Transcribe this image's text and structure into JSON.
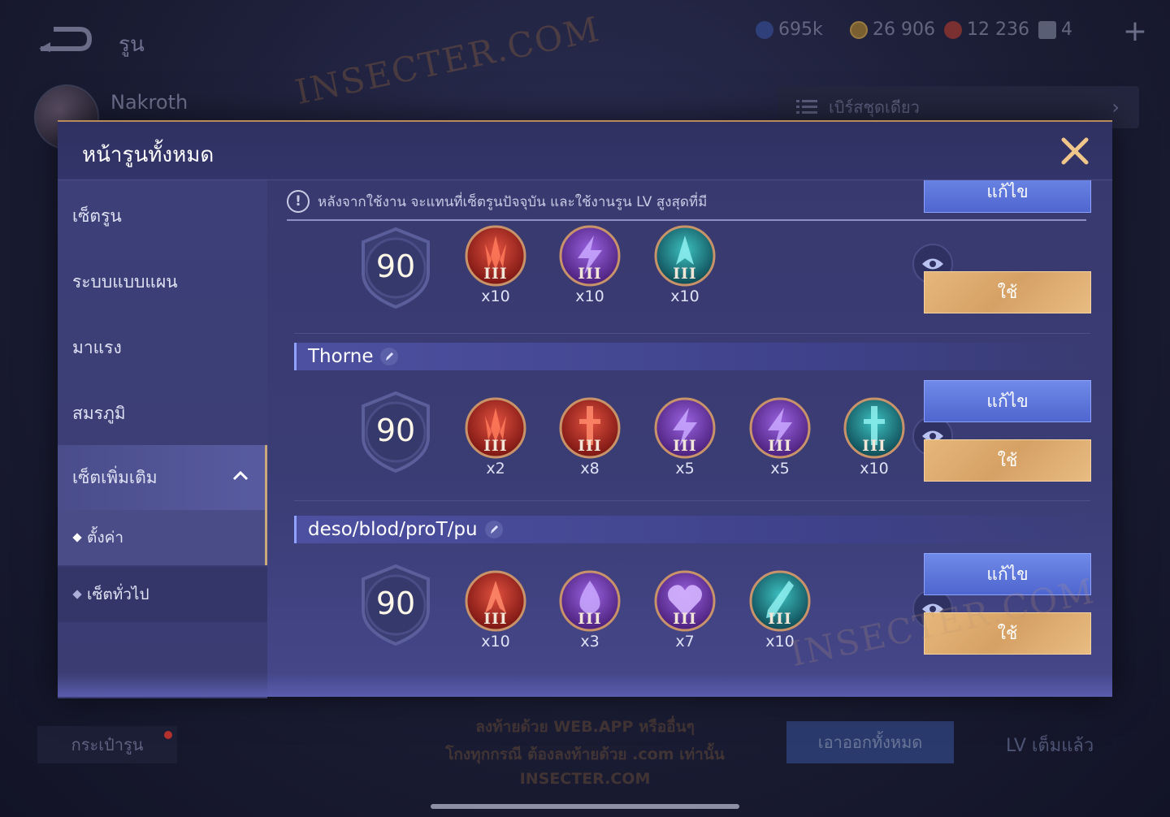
{
  "background": {
    "screen_title": "รูน",
    "resources": [
      {
        "icon": "diamond-gem-icon",
        "value": "695k",
        "color": "#3d5fd0"
      },
      {
        "icon": "gold-coin-icon",
        "value": "26 906",
        "color": "#d8a030"
      },
      {
        "icon": "ruby-gem-icon",
        "value": "12 236",
        "color": "#c33b2e"
      },
      {
        "icon": "rune-ticket-icon",
        "value": "4",
        "color": "#c7ccd8"
      }
    ],
    "hero_name": "Nakroth",
    "single_set_label": "เบิร์สชุดเดียว",
    "watermark_text": "INSECTER.COM",
    "bottom_left_button": "กระเป๋ารูน",
    "remove_all_button": "เอาออกทั้งหมด",
    "lv_full_label": "LV เต็มแล้ว",
    "notice_line1": "ลงท้ายด้วย WEB.APP หรืออื่นๆ",
    "notice_line2": "โกงทุกกรณี ต้องลงท้ายด้วย .com เท่านั้น",
    "notice_line3": "INSECTER.COM"
  },
  "modal": {
    "title": "หน้ารูนทั้งหมด",
    "info_text": "หลังจากใช้งาน จะแทนที่เซ็ตรูนปัจจุบัน และใช้งานรูน LV สูงสุดที่มี",
    "sidebar": {
      "items": [
        {
          "label": "เซ็ตรูน"
        },
        {
          "label": "ระบบแบบแผน"
        },
        {
          "label": "มาแรง"
        },
        {
          "label": "สมรภูมิ"
        },
        {
          "label": "เซ็ตเพิ่มเติม"
        }
      ],
      "sub_items": [
        {
          "label": "ตั้งค่า"
        },
        {
          "label": "เซ็ตทั่วไป"
        }
      ]
    },
    "sets": [
      {
        "name": "",
        "level": "90",
        "edit_label": "แก้ไข",
        "use_label": "ใช้",
        "runes": [
          {
            "icon": "red-claw-rune-icon",
            "color": "red",
            "tier": "III",
            "count": "x10"
          },
          {
            "icon": "purple-bolt-rune-icon",
            "color": "purple",
            "tier": "III",
            "count": "x10"
          },
          {
            "icon": "teal-fang-rune-icon",
            "color": "teal",
            "tier": "III",
            "count": "x10"
          }
        ]
      },
      {
        "name": "Thorne",
        "level": "90",
        "edit_label": "แก้ไข",
        "use_label": "ใช้",
        "runes": [
          {
            "icon": "red-claw-rune-icon",
            "color": "red",
            "tier": "III",
            "count": "x2"
          },
          {
            "icon": "red-sword-rune-icon",
            "color": "red",
            "tier": "III",
            "count": "x8"
          },
          {
            "icon": "purple-bolt-rune-icon",
            "color": "purple",
            "tier": "III",
            "count": "x5"
          },
          {
            "icon": "purple-bolt-rune-icon",
            "color": "purple",
            "tier": "III",
            "count": "x5"
          },
          {
            "icon": "teal-sword-rune-icon",
            "color": "teal",
            "tier": "III",
            "count": "x10"
          }
        ]
      },
      {
        "name": "deso/blod/proT/pu",
        "level": "90",
        "edit_label": "แก้ไข",
        "use_label": "ใช้",
        "runes": [
          {
            "icon": "red-fang-rune-icon",
            "color": "red",
            "tier": "III",
            "count": "x10"
          },
          {
            "icon": "purple-drop-rune-icon",
            "color": "purple",
            "tier": "III",
            "count": "x3"
          },
          {
            "icon": "purple-heart-rune-icon",
            "color": "purple",
            "tier": "III",
            "count": "x7"
          },
          {
            "icon": "teal-blade-rune-icon",
            "color": "teal",
            "tier": "III",
            "count": "x10"
          }
        ]
      }
    ]
  },
  "colors": {
    "accent_gold": "#e0b278",
    "edit_blue": "#5a72d8",
    "rune_red": "#b8322c",
    "rune_purple": "#7a3fbf",
    "rune_teal": "#1e8a8c"
  }
}
